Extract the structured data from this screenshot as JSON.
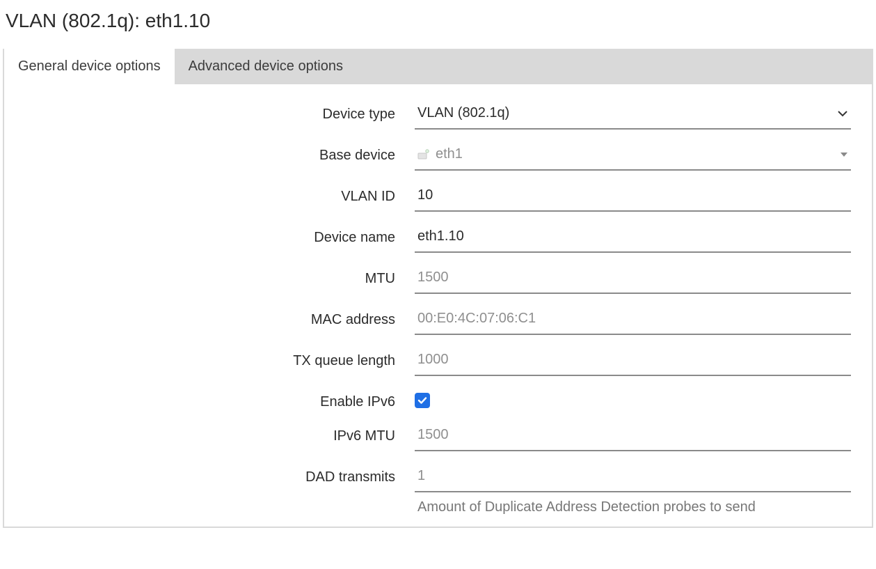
{
  "title": "VLAN (802.1q): eth1.10",
  "tabs": {
    "general": "General device options",
    "advanced": "Advanced device options"
  },
  "labels": {
    "device_type": "Device type",
    "base_device": "Base device",
    "vlan_id": "VLAN ID",
    "device_name": "Device name",
    "mtu": "MTU",
    "mac_address": "MAC address",
    "txqueuelen": "TX queue length",
    "enable_ipv6": "Enable IPv6",
    "ipv6_mtu": "IPv6 MTU",
    "dad_transmits": "DAD transmits"
  },
  "values": {
    "device_type": "VLAN (802.1q)",
    "base_device": "eth1",
    "vlan_id": "10",
    "device_name": "eth1.10",
    "enable_ipv6": true
  },
  "placeholders": {
    "mtu": "1500",
    "mac_address": "00:E0:4C:07:06:C1",
    "txqueuelen": "1000",
    "ipv6_mtu": "1500",
    "dad_transmits": "1"
  },
  "help": {
    "dad_transmits": "Amount of Duplicate Address Detection probes to send"
  }
}
